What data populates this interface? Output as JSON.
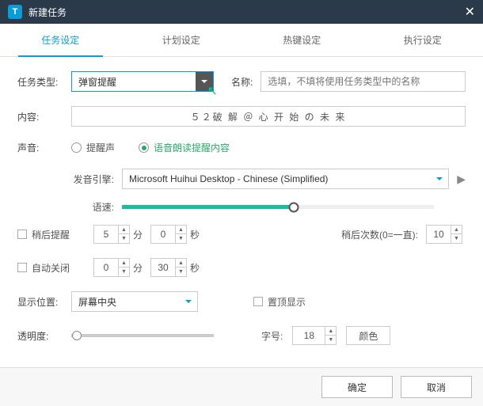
{
  "window": {
    "title": "新建任务"
  },
  "tabs": {
    "t0": "任务设定",
    "t1": "计划设定",
    "t2": "热键设定",
    "t3": "执行设定"
  },
  "type": {
    "label": "任务类型:",
    "value": "弹窗提醒"
  },
  "name": {
    "label": "名称:",
    "placeholder": "选填，不填将使用任务类型中的名称"
  },
  "content": {
    "label": "内容:",
    "value": "５２破 解 ＠ 心 开 始 の 未 来"
  },
  "sound": {
    "label": "声音:",
    "opt_beep": "提醒声",
    "opt_tts": "语音朗读提醒内容",
    "selected": "tts",
    "engine_label": "发音引擎:",
    "engine_value": "Microsoft Huihui Desktop - Chinese (Simplified)",
    "speed_label": "语速:",
    "speed_value": 5
  },
  "later": {
    "label": "稍后提醒",
    "min": "5",
    "sec": "0",
    "unit_min": "分",
    "unit_sec": "秒",
    "count_label": "稍后次数(0=一直):",
    "count": "10"
  },
  "autoclose": {
    "label": "自动关闭",
    "min": "0",
    "sec": "30"
  },
  "position": {
    "label": "显示位置:",
    "value": "屏幕中央",
    "topmost_label": "置顶显示"
  },
  "opacity": {
    "label": "透明度:",
    "value": 4
  },
  "font": {
    "label": "字号:",
    "value": "18",
    "color_label": "颜色"
  },
  "buttons": {
    "ok": "确定",
    "cancel": "取消"
  }
}
